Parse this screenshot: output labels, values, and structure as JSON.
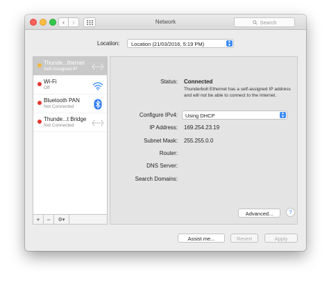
{
  "window": {
    "title": "Network"
  },
  "search": {
    "placeholder": "Search"
  },
  "location": {
    "label": "Location:",
    "value": "Location (21/03/2016, 5:19 PM)"
  },
  "services": [
    {
      "name": "Thunde...thernet",
      "status": "Self-Assigned IP",
      "dot_color": "#f3b63a",
      "icon": "ethernet-arrows-icon",
      "selected": true
    },
    {
      "name": "Wi-Fi",
      "status": "Off",
      "dot_color": "#e5372e",
      "icon": "wifi-icon",
      "selected": false
    },
    {
      "name": "Bluetooth PAN",
      "status": "Not Connected",
      "dot_color": "#e5372e",
      "icon": "bluetooth-icon",
      "selected": false
    },
    {
      "name": "Thunde...t Bridge",
      "status": "Not Connected",
      "dot_color": "#e5372e",
      "icon": "ethernet-arrows-icon",
      "selected": false
    }
  ],
  "sidebar_footer": {
    "add": "+",
    "remove": "−",
    "gear": "⚙▾"
  },
  "detail": {
    "status_label": "Status:",
    "status_value": "Connected",
    "status_note": "Thunderbolt Ethernet has a self-assigned IP address and will not be able to connect to the Internet.",
    "configure_label": "Configure IPv4:",
    "configure_value": "Using DHCP",
    "ip_label": "IP Address:",
    "ip_value": "169.254.23.19",
    "subnet_label": "Subnet Mask:",
    "subnet_value": "255.255.0.0",
    "router_label": "Router:",
    "dns_label": "DNS Server:",
    "search_domains_label": "Search Domains:",
    "advanced_button": "Advanced...",
    "help_button": "?"
  },
  "footer": {
    "assist": "Assist me...",
    "revert": "Revert",
    "apply": "Apply"
  },
  "colors": {
    "accent": "#3d8cf5",
    "bluetooth": "#2f7bf2"
  }
}
